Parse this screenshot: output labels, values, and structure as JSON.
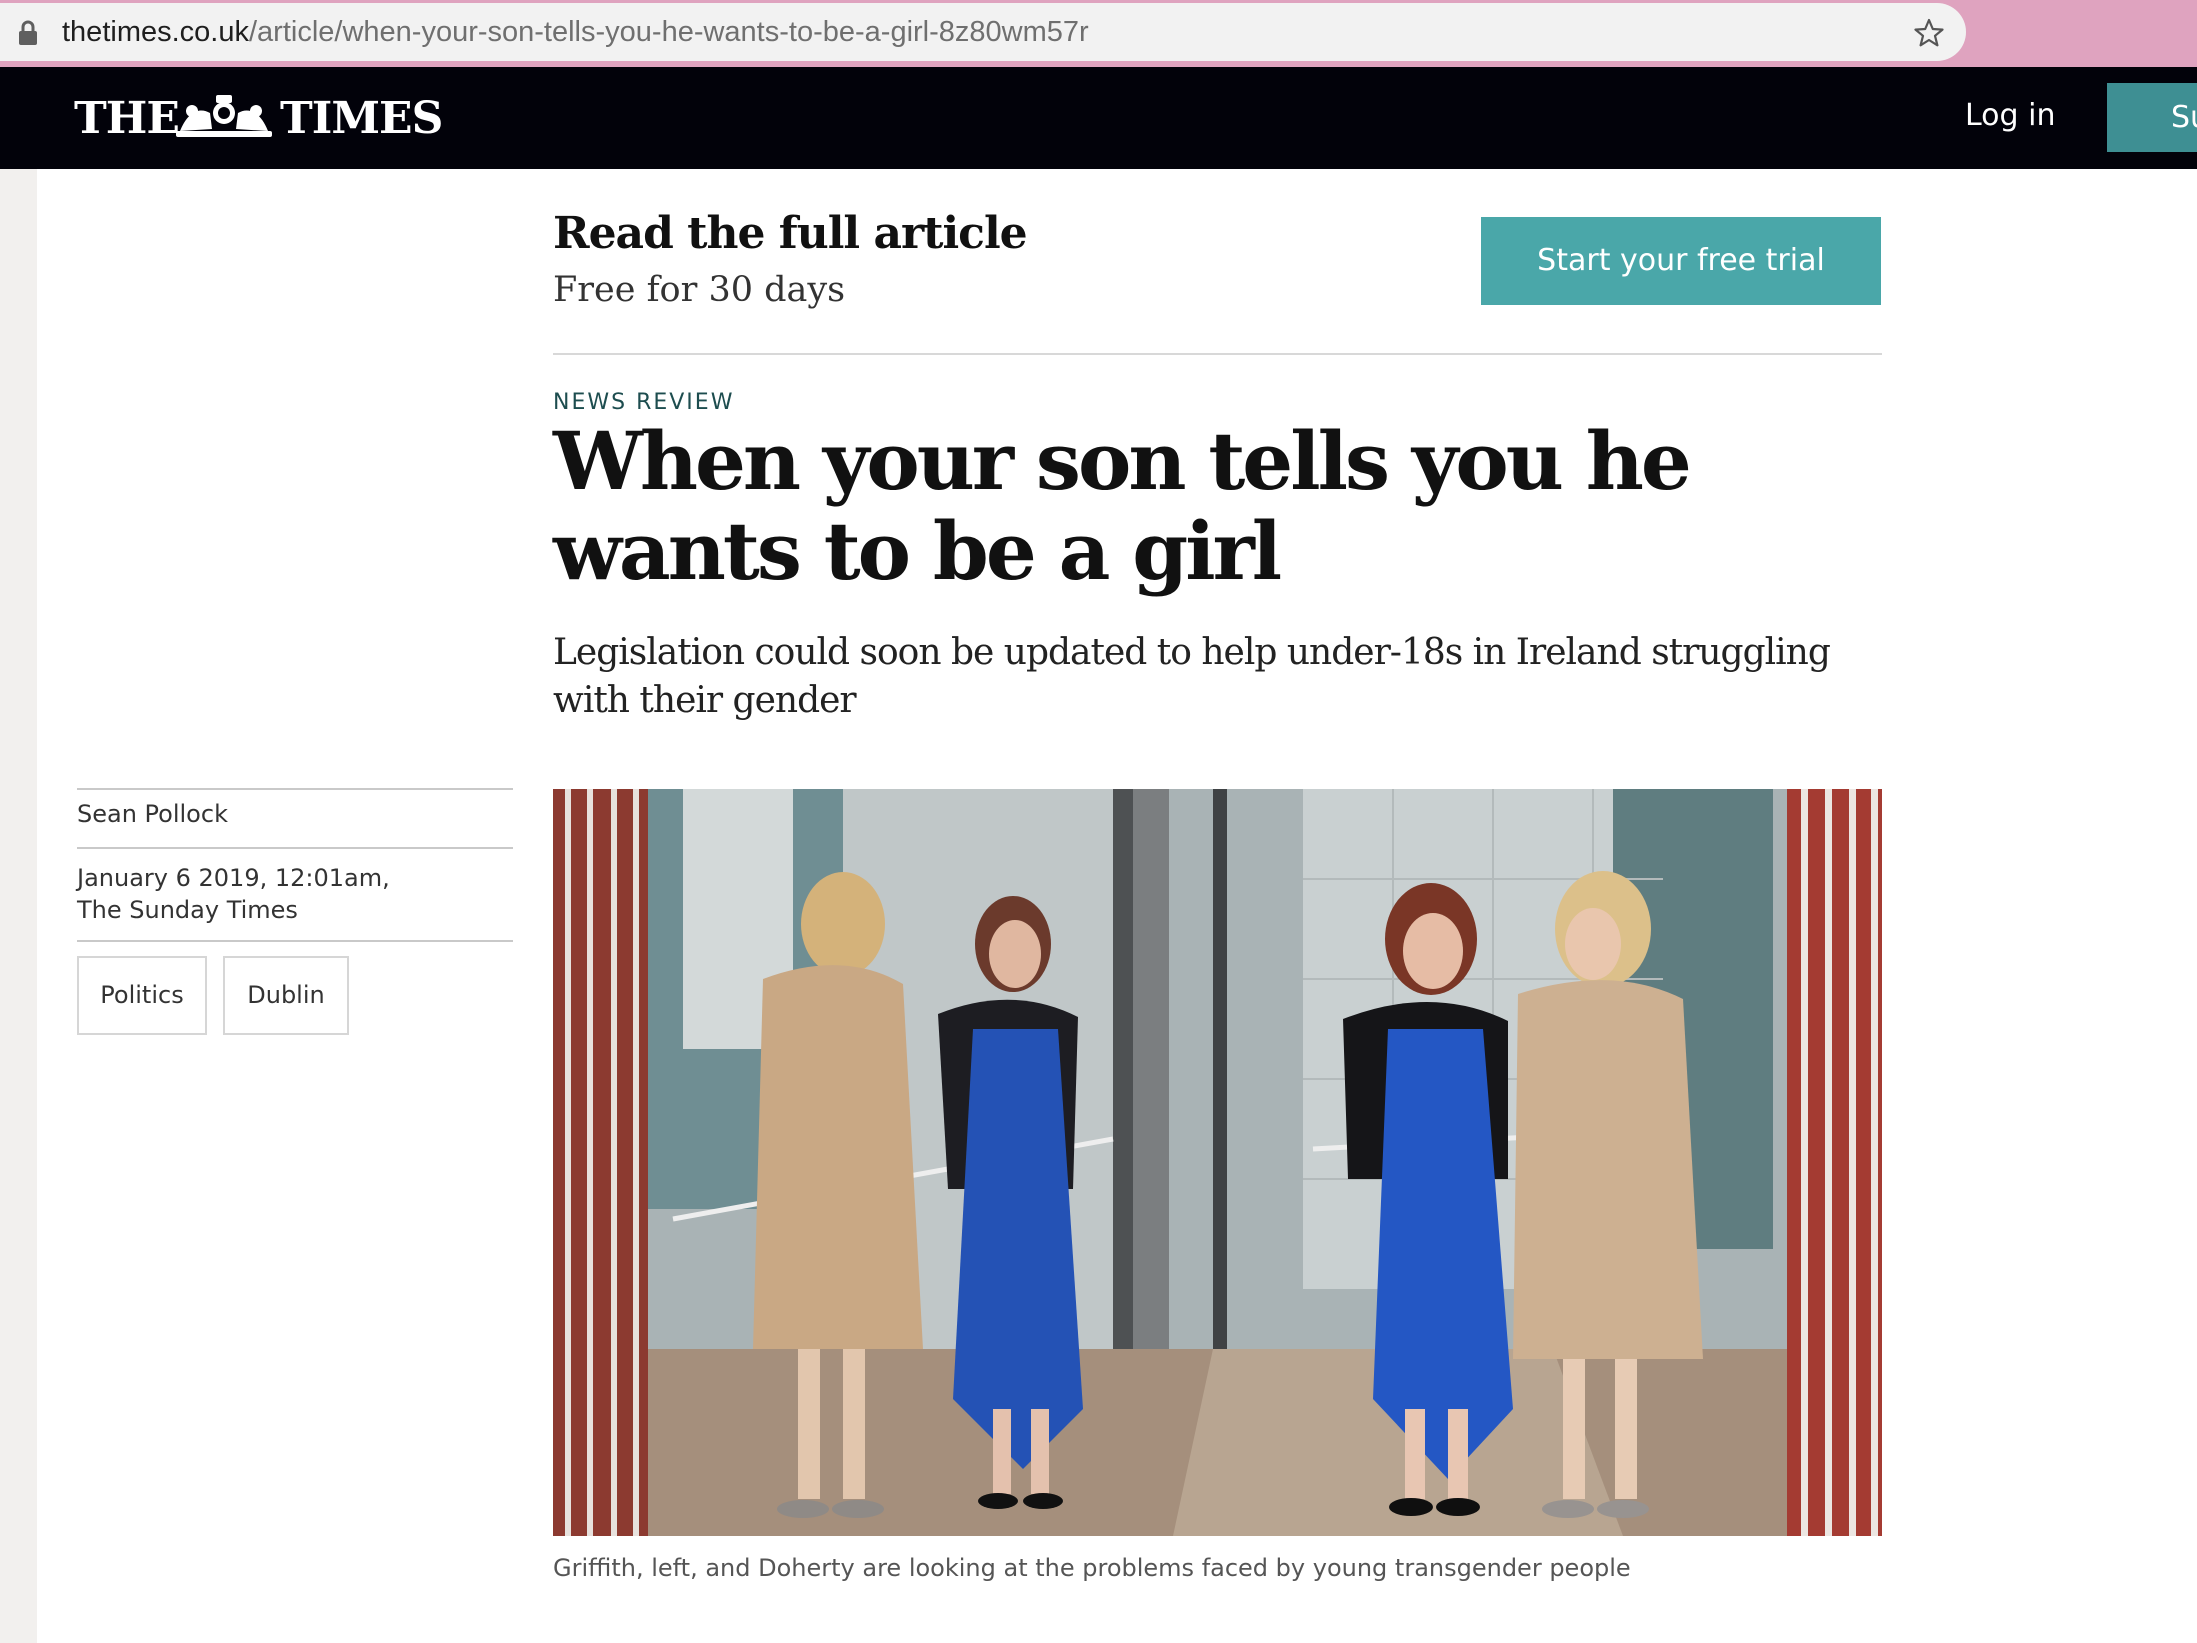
{
  "browser": {
    "url_host": "thetimes.co.uk",
    "url_path": "/article/when-your-son-tells-you-he-wants-to-be-a-girl-8z80wm57r"
  },
  "header": {
    "logo_left": "THE",
    "logo_right": "TIMES",
    "login_label": "Log in",
    "subscribe_label": "Subscribe",
    "background": "#02020a",
    "accent": "#3e8f93"
  },
  "promo": {
    "title": "Read the full article",
    "subtitle": "Free for 30 days",
    "cta_label": "Start your free trial",
    "cta_color": "#4aa7a9"
  },
  "article": {
    "section": "NEWS REVIEW",
    "headline": "When your son tells you he wants to be a girl",
    "standfirst": "Legislation could soon be updated to help under-18s in Ireland struggling with their gender",
    "author": "Sean Pollock",
    "date": "January 6 2019, 12:01am,",
    "publication": "The Sunday Times",
    "tags": [
      "Politics",
      "Dublin"
    ],
    "image_caption": "Griffith, left, and Doherty are looking at the problems faced by young transgender people"
  }
}
